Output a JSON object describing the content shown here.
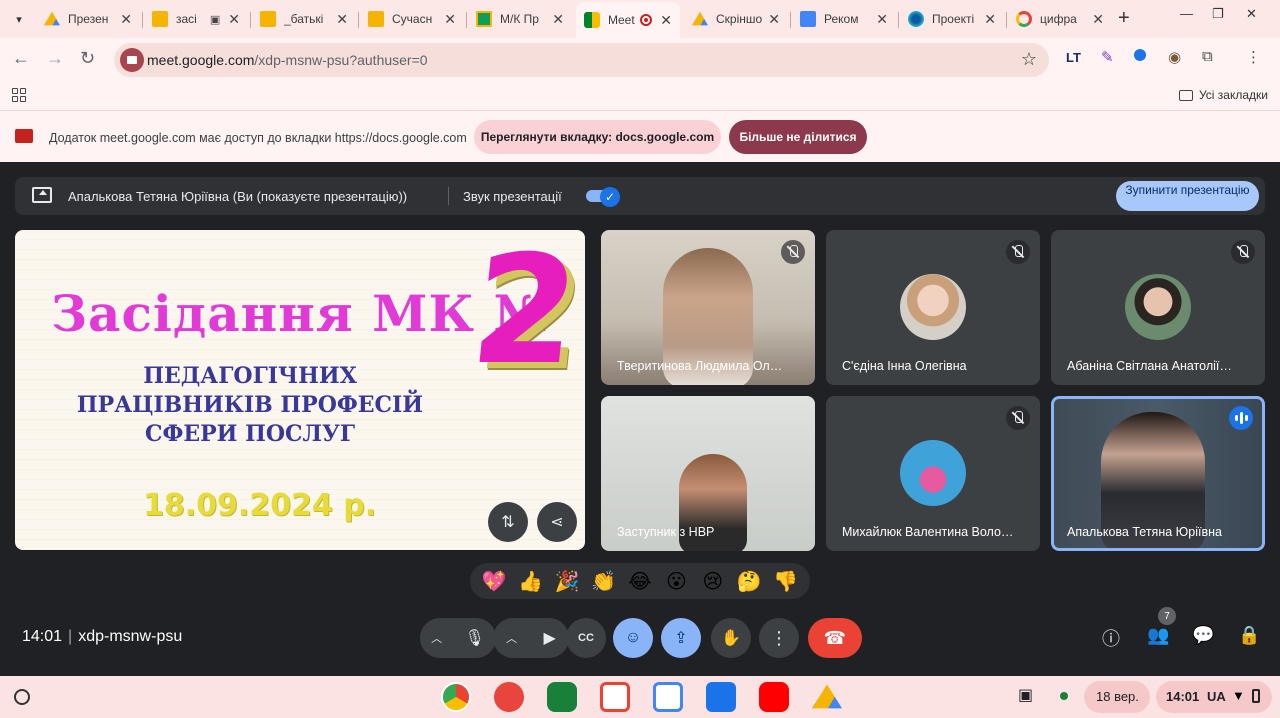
{
  "browser": {
    "tabs": [
      {
        "title": "Презен",
        "favicon": "google-drive"
      },
      {
        "title": "засі",
        "favicon": "google-slides"
      },
      {
        "title": "_батькі",
        "favicon": "google-slides"
      },
      {
        "title": "Сучасн",
        "favicon": "google-slides"
      },
      {
        "title": "М/К Пр",
        "favicon": "google-classroom"
      },
      {
        "title": "Meet",
        "favicon": "google-meet",
        "active": true
      },
      {
        "title": "Скріншо",
        "favicon": "google-drive"
      },
      {
        "title": "Реком",
        "favicon": "google-docs"
      },
      {
        "title": "Проекті",
        "favicon": "edge"
      },
      {
        "title": "цифра",
        "favicon": "google"
      }
    ],
    "url_host": "meet.google.com",
    "url_path": "/xdp-msnw-psu?authuser=0",
    "bookmarks_all": "Усі закладки",
    "share_notice": "Додаток meet.google.com має доступ до вкладки https://docs.google.com",
    "view_tab_button": "Переглянути вкладку: docs.google.com",
    "stop_sharing_button": "Більше не ділитися"
  },
  "meet": {
    "presenter_text": "Апалькова Тетяна Юріївна (Ви (показуєте презентацію))",
    "presentation_sound": "Звук презентації",
    "stop_presenting": "Зупинити презентацію",
    "slide": {
      "title": "Засідання МК №",
      "number": "2",
      "subtitle_lines": [
        "ПЕДАГОГІЧНИХ",
        "ПРАЦІВНИКІВ ПРОФЕСІЙ",
        "СФЕРИ ПОСЛУГ"
      ],
      "date": "18.09.2024 р."
    },
    "participants": [
      {
        "name": "Тверитинова Людмила Ол…",
        "muted": true,
        "video": true
      },
      {
        "name": "С'єдіна Інна Олегівна",
        "muted": true,
        "video": false
      },
      {
        "name": "Абаніна Світлана Анатолії…",
        "muted": true,
        "video": false
      },
      {
        "name": "Заступник з НВР",
        "muted": false,
        "video": true
      },
      {
        "name": "Михайлюк Валентина Воло…",
        "muted": true,
        "video": false
      },
      {
        "name": "Апалькова Тетяна Юріївна",
        "muted": false,
        "video": true,
        "speaking": true
      }
    ],
    "reactions": [
      "💖",
      "👍",
      "🎉",
      "👏",
      "😂",
      "😮",
      "😢",
      "🤔",
      "👎"
    ],
    "time": "14:01",
    "meeting_code": "xdp-msnw-psu",
    "participants_count": "7"
  },
  "shelf": {
    "date": "18 вер.",
    "time": "14:01",
    "locale": "UA"
  },
  "colors": {
    "meet_bg": "#202124",
    "accent_blue": "#8ab4f8",
    "end_call_red": "#ea4335",
    "slide_title_magenta": "#e23ad6",
    "slide_subtitle_blue": "#39379a",
    "slide_date_yellow": "#e6db3a"
  }
}
